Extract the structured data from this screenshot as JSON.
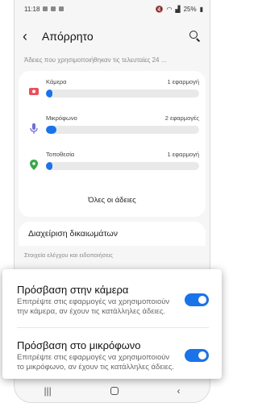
{
  "status_bar": {
    "time": "11:18",
    "battery": "25%"
  },
  "header": {
    "title": "Απόρρητο",
    "back_icon": "arrow-back-icon",
    "search_icon": "search-icon"
  },
  "subtitle": "Άδειες που χρησιμοποιήθηκαν τις τελευταίες 24 ...",
  "permissions": [
    {
      "label": "Κάμερα",
      "count": "1 εφαρμογή",
      "icon": "camera-icon",
      "color": "#e8505b",
      "usage": 0.04
    },
    {
      "label": "Μικρόφωνο",
      "count": "2 εφαρμογές",
      "icon": "microphone-icon",
      "color": "#6e6ed8",
      "usage": 0.07
    },
    {
      "label": "Τοποθεσία",
      "count": "1 εφαρμογή",
      "icon": "location-icon",
      "color": "#39a74a",
      "usage": 0.04
    }
  ],
  "all_permissions_label": "Όλες οι άδειες",
  "manage_label": "Διαχείριση δικαιωμάτων",
  "controls_section_label": "Στοιχεία ελέγχου και ειδοποιήσεις",
  "toggles": [
    {
      "title": "Πρόσβαση στην κάμερα",
      "description": "Επιτρέψτε στις εφαρμογές να χρησιμοποιούν την κάμερα, αν έχουν τις κατάλληλες άδειες.",
      "on": true
    },
    {
      "title": "Πρόσβαση στο μικρόφωνο",
      "description": "Επιτρέψτε στις εφαρμογές να χρησιμοποιούν το μικρόφωνο, αν έχουν τις κατάλληλες άδειες.",
      "on": true
    }
  ],
  "colors": {
    "accent": "#1a73e8",
    "background": "#f6f6f6"
  }
}
